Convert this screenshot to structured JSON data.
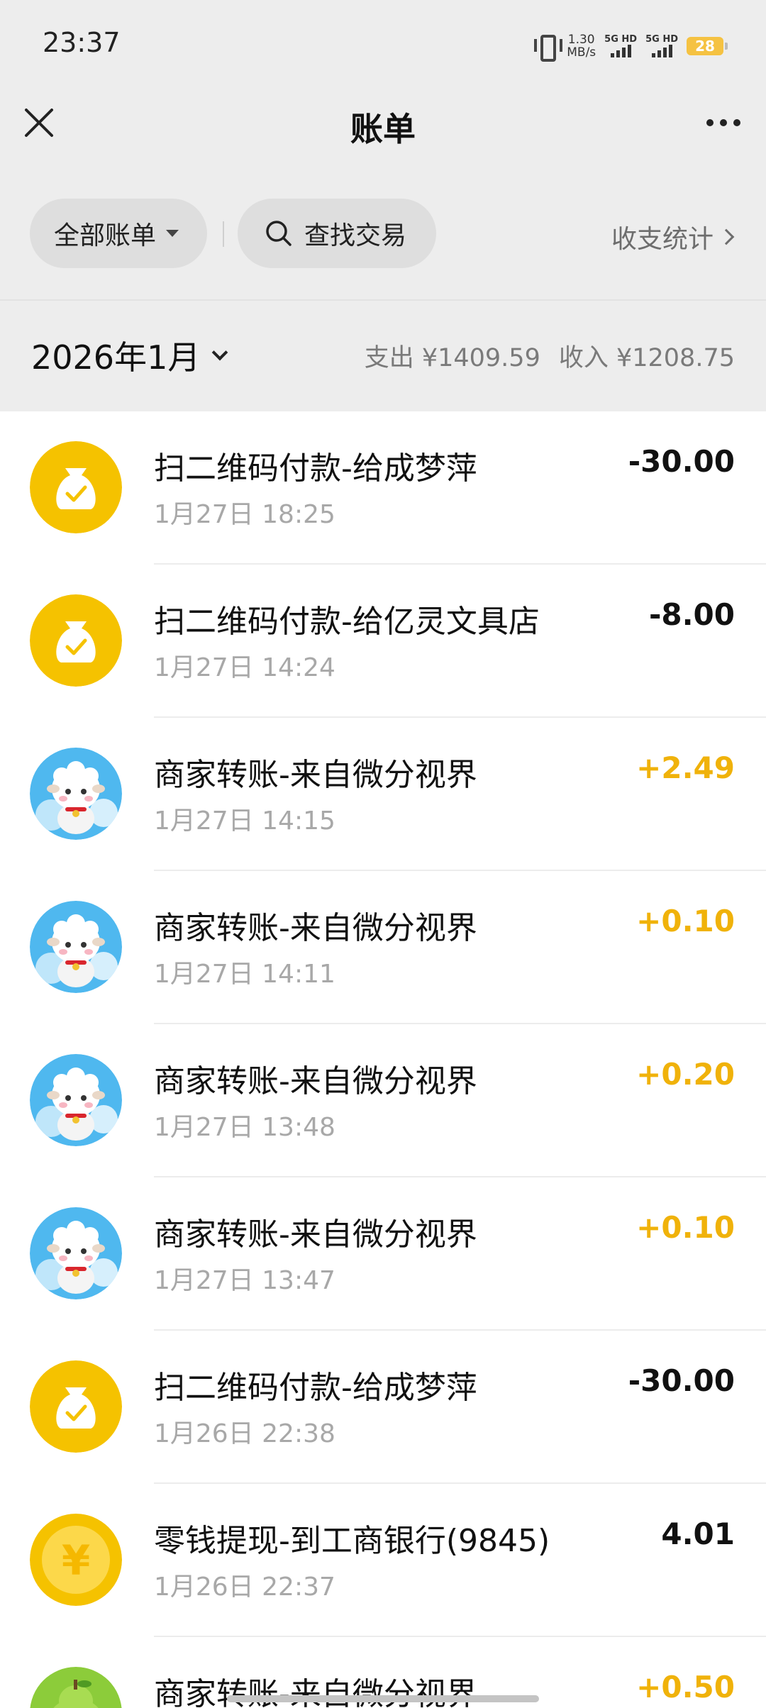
{
  "status_bar": {
    "time": "23:37",
    "net_speed_value": "1.30",
    "net_speed_unit": "MB/s",
    "sim1_label": "5G HD",
    "sim2_label": "5G HD",
    "battery": "28"
  },
  "header": {
    "title": "账单",
    "close_icon": "close-icon",
    "more_icon": "more-icon"
  },
  "filters": {
    "all_bills_label": "全部账单",
    "search_label": "查找交易",
    "stats_label": "收支统计"
  },
  "summary": {
    "month": "2026年1月",
    "expense": "支出 ¥1409.59",
    "income": "收入 ¥1208.75"
  },
  "transactions": [
    {
      "title": "扫二维码付款-给成梦萍",
      "time": "1月27日 18:25",
      "amount": "-30.00",
      "kind": "expense",
      "icon": "wallet-bag-icon"
    },
    {
      "title": "扫二维码付款-给亿灵文具店",
      "time": "1月27日 14:24",
      "amount": "-8.00",
      "kind": "expense",
      "icon": "wallet-bag-icon"
    },
    {
      "title": "商家转账-来自微分视界",
      "time": "1月27日 14:15",
      "amount": "+2.49",
      "kind": "income",
      "icon": "sheep-avatar"
    },
    {
      "title": "商家转账-来自微分视界",
      "time": "1月27日 14:11",
      "amount": "+0.10",
      "kind": "income",
      "icon": "sheep-avatar"
    },
    {
      "title": "商家转账-来自微分视界",
      "time": "1月27日 13:48",
      "amount": "+0.20",
      "kind": "income",
      "icon": "sheep-avatar"
    },
    {
      "title": "商家转账-来自微分视界",
      "time": "1月27日 13:47",
      "amount": "+0.10",
      "kind": "income",
      "icon": "sheep-avatar"
    },
    {
      "title": "扫二维码付款-给成梦萍",
      "time": "1月26日 22:38",
      "amount": "-30.00",
      "kind": "expense",
      "icon": "wallet-bag-icon"
    },
    {
      "title": "零钱提现-到工商银行(9845)",
      "time": "1月26日 22:37",
      "amount": "4.01",
      "kind": "transfer",
      "icon": "yuan-coin-icon"
    },
    {
      "title": "商家转账-来自微分视界",
      "time": "",
      "amount": "+0.50",
      "kind": "income",
      "icon": "pear-avatar"
    }
  ],
  "colors": {
    "accent_yellow": "#f5c200",
    "income_amount": "#f0b20a",
    "header_bg": "#ededed"
  }
}
